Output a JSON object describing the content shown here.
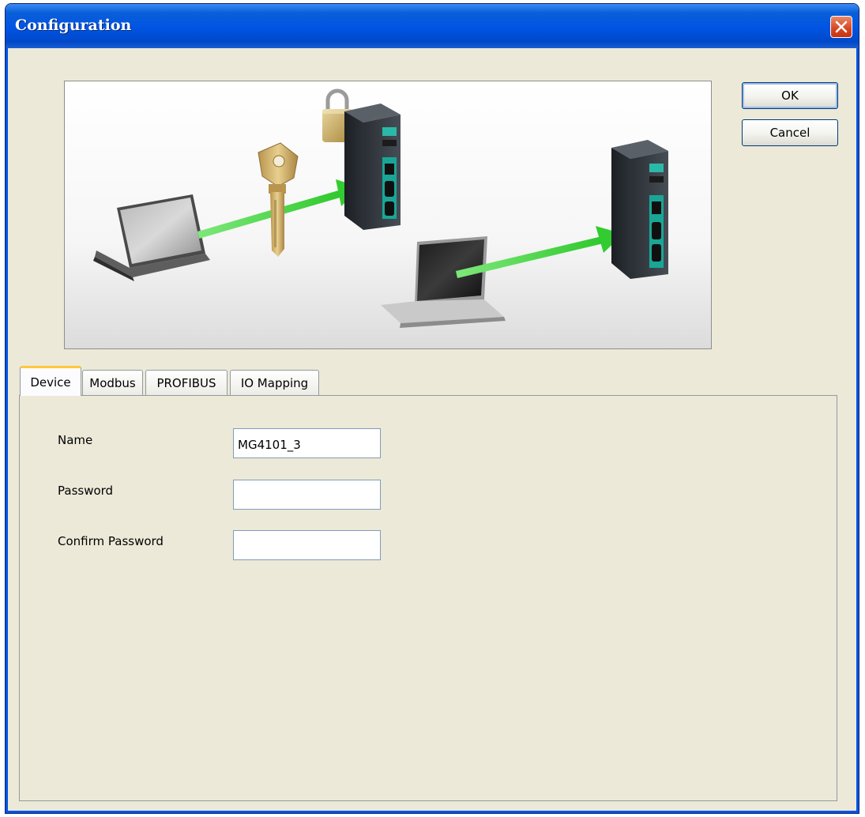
{
  "window": {
    "title": "Configuration",
    "close_icon": "close-icon"
  },
  "buttons": {
    "ok_label": "OK",
    "cancel_label": "Cancel"
  },
  "tabs": [
    {
      "label": "Device",
      "active": true
    },
    {
      "label": "Modbus",
      "active": false
    },
    {
      "label": "PROFIBUS",
      "active": false
    },
    {
      "label": "IO Mapping",
      "active": false
    }
  ],
  "device_form": {
    "name_label": "Name",
    "name_value": "MG4101_3",
    "password_label": "Password",
    "password_value": "",
    "confirm_label": "Confirm Password",
    "confirm_value": ""
  },
  "colors": {
    "titlebar": "#0054e3",
    "dialog_bg": "#ece9d8",
    "close_button": "#d8461f",
    "active_tab_accent": "#ffc83c",
    "link_arrow": "#4cd84a"
  }
}
